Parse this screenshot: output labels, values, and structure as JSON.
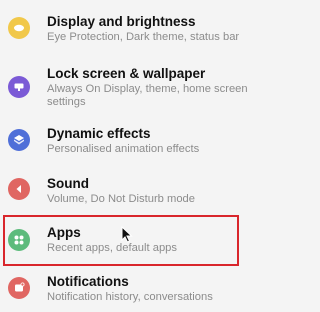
{
  "settings": {
    "items": [
      {
        "id": "display",
        "title": "Display and brightness",
        "subtitle": "Eye Protection, Dark theme, status bar",
        "icon": "sun-icon",
        "color": "#f1c84a"
      },
      {
        "id": "lock",
        "title": "Lock screen & wallpaper",
        "subtitle": "Always On Display, theme, home screen settings",
        "icon": "wallpaper-icon",
        "color": "#7b5ad6"
      },
      {
        "id": "effects",
        "title": "Dynamic effects",
        "subtitle": "Personalised animation effects",
        "icon": "cube-icon",
        "color": "#4f6fd8"
      },
      {
        "id": "sound",
        "title": "Sound",
        "subtitle": "Volume, Do Not Disturb mode",
        "icon": "speaker-icon",
        "color": "#e06662"
      },
      {
        "id": "apps",
        "title": "Apps",
        "subtitle": "Recent apps, default apps",
        "icon": "apps-grid-icon",
        "color": "#5dbb7c"
      },
      {
        "id": "notifications",
        "title": "Notifications",
        "subtitle": "Notification history, conversations",
        "icon": "notification-icon",
        "color": "#e06662"
      }
    ]
  },
  "highlight_color": "#d9262c"
}
